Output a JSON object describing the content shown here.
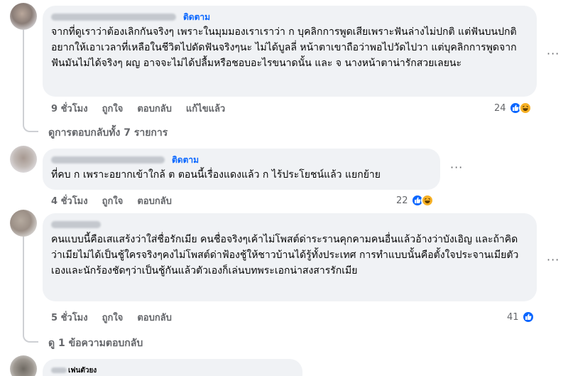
{
  "comments": [
    {
      "follow_label": "ติดตาม",
      "text": "จากที่ดูเราว่าต้องเลิกกันจริงๆ เพราะในมุมมองเราเราว่า ก บุคลิกการพูดเสียเพราะฟันล่างไม่ปกติ แต่ฟันบนปกติ อยากให้เอาเวลาที่เหลือในชีวิตไปดัดฟันจริงๆนะ ไม่ได้บูลลี่ หน้าตาเขาถือว่าพอไปวัดไปวา แต่บุคลิกการพูดจากฟันมันไม่ได้จริงๆ ผญ อาจจะไม่ได้ปลื้มหรือชอบอะไรขนาดนั้น และ จ นางหน้าตาน่ารักสวยเลยนะ",
      "time": "9 ชั่วโมง",
      "like_label": "ถูกใจ",
      "reply_label": "ตอบกลับ",
      "edited_label": "แก้ไขแล้ว",
      "reaction_count": "24",
      "view_replies": "ดูการตอบกลับทั้ง 7 รายการ"
    },
    {
      "follow_label": "ติดตาม",
      "text": "ที่คบ ก เพราะอยากเข้าใกล้ ต ตอนนี้เรื่องแดงแล้ว ก ไร้ประโยชน์แล้ว แยกย้าย",
      "time": "4 ชั่วโมง",
      "like_label": "ถูกใจ",
      "reply_label": "ตอบกลับ",
      "reaction_count": "22"
    },
    {
      "text": "คนแบบนี้คือเสแสร้งว่าใส่ชื่อรักเมีย คนชื่อจริงๆเค้าไม่โพสต์ด่าระรานคุกคามคนอื่นแล้วอ้างว่าบังเอิญ และถ้าคิดว่าเมียไม่ได้เป็นชู้ใครจริงๆคงไม่โพสต์ด่าฟ้องชู้ให้ชาวบ้านได้รู้ทั้งประเทศ การทำแบบนั้นคือตั้งใจประจานเมียตัวเองและนักร้องชัดๆว่าเป็นชู้กันแล้วตัวเองก็เล่นบทพระเอกน่าสงสารรักเมีย",
      "time": "5 ชั่วโมง",
      "like_label": "ถูกใจ",
      "reply_label": "ตอบกลับ",
      "reaction_count": "41",
      "view_replies": "ดู 1 ข้อความตอบกลับ"
    },
    {
      "name_suffix": "เฟนตัวยง"
    }
  ],
  "more_icon_text": "···",
  "colors": {
    "bubble": "#f0f2f5",
    "accent": "#0866ff",
    "muted": "#65676b",
    "haha": "#f7b125"
  }
}
